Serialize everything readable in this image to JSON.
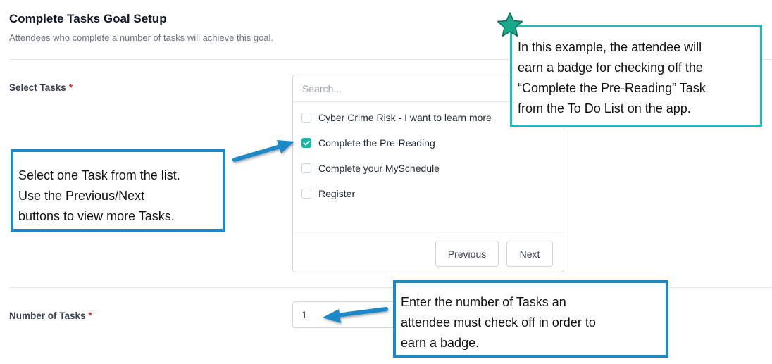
{
  "header": {
    "title": "Complete Tasks Goal Setup",
    "subtitle": "Attendees who complete a number of tasks will achieve this goal."
  },
  "select_tasks": {
    "label": "Select Tasks",
    "required_mark": "*",
    "search_placeholder": "Search...",
    "items": [
      {
        "label": "Cyber Crime Risk - I want to learn more",
        "checked": false
      },
      {
        "label": "Complete the Pre-Reading",
        "checked": true
      },
      {
        "label": "Complete your MySchedule",
        "checked": false
      },
      {
        "label": "Register",
        "checked": false
      }
    ],
    "previous_label": "Previous",
    "next_label": "Next"
  },
  "number_of_tasks": {
    "label": "Number of Tasks",
    "required_mark": "*",
    "value": "1"
  },
  "annotations": {
    "select_note": [
      "Select one Task from the list.",
      "Use the Previous/Next",
      "buttons to view more Tasks."
    ],
    "example_note": [
      "In this example, the attendee will",
      "earn a badge for checking off the",
      "“Complete the Pre-Reading” Task",
      "from the To Do List on the app."
    ],
    "number_note": [
      "Enter the number of Tasks an",
      "attendee must check off in order to",
      "earn a badge."
    ]
  },
  "colors": {
    "accent": "#14b8a6",
    "callout_blue": "#1e88c7",
    "callout_teal": "#14c0c0",
    "required": "#dc2626"
  }
}
